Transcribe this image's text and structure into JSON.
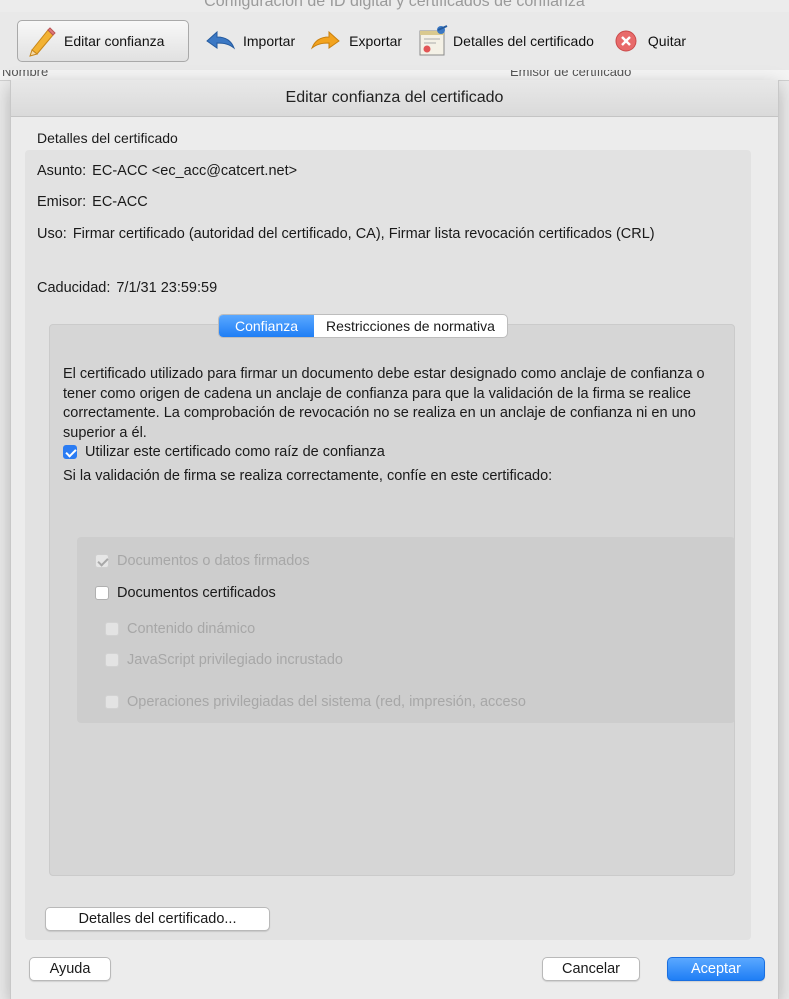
{
  "background_window": {
    "title": "Configuración de ID digital y certificados de confianza",
    "list_headers": [
      "Nombre",
      "Emisor de certificado"
    ]
  },
  "toolbar": {
    "items": [
      {
        "label": "Editar confianza",
        "icon": "pencil-icon"
      },
      {
        "label": "Importar",
        "icon": "arrow-left-icon"
      },
      {
        "label": "Exportar",
        "icon": "arrow-right-icon"
      },
      {
        "label": "Detalles del certificado",
        "icon": "certificate-icon"
      },
      {
        "label": "Quitar",
        "icon": "remove-circle-icon"
      }
    ]
  },
  "dialog": {
    "title": "Editar confianza del certificado",
    "section_label": "Detalles del certificado",
    "fields": {
      "asunto_label": "Asunto:",
      "asunto_value": "EC-ACC <ec_acc@catcert.net>",
      "emisor_label": "Emisor:",
      "emisor_value": "EC-ACC",
      "uso_label": "Uso:",
      "uso_value": "Firmar certificado (autoridad del certificado, CA), Firmar lista revocación certificados (CRL)",
      "caducidad_label": "Caducidad:",
      "caducidad_value": "7/1/31 23:59:59"
    },
    "tabs": [
      {
        "label": "Confianza",
        "selected": true
      },
      {
        "label": "Restricciones de normativa",
        "selected": false
      }
    ],
    "trust_panel": {
      "description": "El certificado utilizado para firmar un documento debe estar designado como anclaje de confianza o tener como origen de cadena un anclaje de confianza para que la validación de la firma se realice correctamente. La comprobación de revocación no se realiza en un anclaje de confianza ni en uno superior a él.",
      "root_checkbox": {
        "label": "Utilizar este certificado como raíz de confianza",
        "checked": true
      },
      "question": "Si la validación de firma se realiza correctamente, confíe en este certificado:",
      "options": [
        {
          "label": "Documentos o datos firmados",
          "checked": true,
          "enabled": false
        },
        {
          "label": "Documentos certificados",
          "checked": false,
          "enabled": true
        },
        {
          "label": "Contenido dinámico",
          "checked": false,
          "enabled": false
        },
        {
          "label": "JavaScript privilegiado incrustado",
          "checked": false,
          "enabled": false
        },
        {
          "label": "Operaciones privilegiadas del sistema (red, impresión, acceso",
          "checked": false,
          "enabled": false
        }
      ]
    },
    "details_button": "Detalles del certificado...",
    "help_button": "Ayuda",
    "cancel_button": "Cancelar",
    "accept_button": "Aceptar"
  },
  "colors": {
    "accent": "#1f7ef5",
    "window_bg": "#ececec",
    "panel_bg": "#d6d6d6"
  }
}
